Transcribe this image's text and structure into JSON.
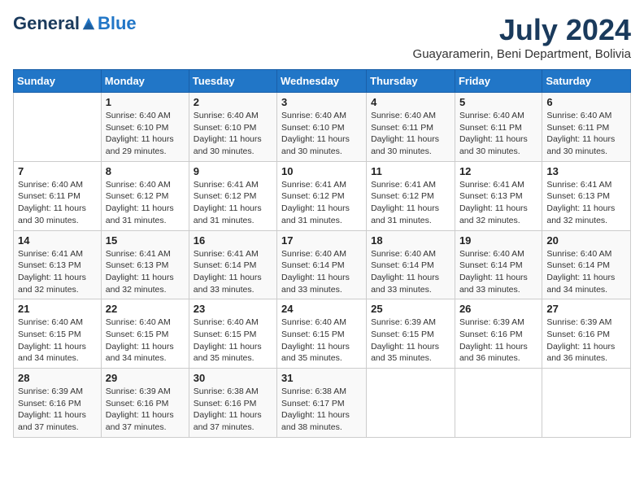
{
  "header": {
    "logo_general": "General",
    "logo_blue": "Blue",
    "month_year": "July 2024",
    "location": "Guayaramerin, Beni Department, Bolivia"
  },
  "weekdays": [
    "Sunday",
    "Monday",
    "Tuesday",
    "Wednesday",
    "Thursday",
    "Friday",
    "Saturday"
  ],
  "weeks": [
    [
      {
        "day": "",
        "sunrise": "",
        "sunset": "",
        "daylight": ""
      },
      {
        "day": "1",
        "sunrise": "Sunrise: 6:40 AM",
        "sunset": "Sunset: 6:10 PM",
        "daylight": "Daylight: 11 hours and 29 minutes."
      },
      {
        "day": "2",
        "sunrise": "Sunrise: 6:40 AM",
        "sunset": "Sunset: 6:10 PM",
        "daylight": "Daylight: 11 hours and 30 minutes."
      },
      {
        "day": "3",
        "sunrise": "Sunrise: 6:40 AM",
        "sunset": "Sunset: 6:10 PM",
        "daylight": "Daylight: 11 hours and 30 minutes."
      },
      {
        "day": "4",
        "sunrise": "Sunrise: 6:40 AM",
        "sunset": "Sunset: 6:11 PM",
        "daylight": "Daylight: 11 hours and 30 minutes."
      },
      {
        "day": "5",
        "sunrise": "Sunrise: 6:40 AM",
        "sunset": "Sunset: 6:11 PM",
        "daylight": "Daylight: 11 hours and 30 minutes."
      },
      {
        "day": "6",
        "sunrise": "Sunrise: 6:40 AM",
        "sunset": "Sunset: 6:11 PM",
        "daylight": "Daylight: 11 hours and 30 minutes."
      }
    ],
    [
      {
        "day": "7",
        "sunrise": "Sunrise: 6:40 AM",
        "sunset": "Sunset: 6:11 PM",
        "daylight": "Daylight: 11 hours and 30 minutes."
      },
      {
        "day": "8",
        "sunrise": "Sunrise: 6:40 AM",
        "sunset": "Sunset: 6:12 PM",
        "daylight": "Daylight: 11 hours and 31 minutes."
      },
      {
        "day": "9",
        "sunrise": "Sunrise: 6:41 AM",
        "sunset": "Sunset: 6:12 PM",
        "daylight": "Daylight: 11 hours and 31 minutes."
      },
      {
        "day": "10",
        "sunrise": "Sunrise: 6:41 AM",
        "sunset": "Sunset: 6:12 PM",
        "daylight": "Daylight: 11 hours and 31 minutes."
      },
      {
        "day": "11",
        "sunrise": "Sunrise: 6:41 AM",
        "sunset": "Sunset: 6:12 PM",
        "daylight": "Daylight: 11 hours and 31 minutes."
      },
      {
        "day": "12",
        "sunrise": "Sunrise: 6:41 AM",
        "sunset": "Sunset: 6:13 PM",
        "daylight": "Daylight: 11 hours and 32 minutes."
      },
      {
        "day": "13",
        "sunrise": "Sunrise: 6:41 AM",
        "sunset": "Sunset: 6:13 PM",
        "daylight": "Daylight: 11 hours and 32 minutes."
      }
    ],
    [
      {
        "day": "14",
        "sunrise": "Sunrise: 6:41 AM",
        "sunset": "Sunset: 6:13 PM",
        "daylight": "Daylight: 11 hours and 32 minutes."
      },
      {
        "day": "15",
        "sunrise": "Sunrise: 6:41 AM",
        "sunset": "Sunset: 6:13 PM",
        "daylight": "Daylight: 11 hours and 32 minutes."
      },
      {
        "day": "16",
        "sunrise": "Sunrise: 6:41 AM",
        "sunset": "Sunset: 6:14 PM",
        "daylight": "Daylight: 11 hours and 33 minutes."
      },
      {
        "day": "17",
        "sunrise": "Sunrise: 6:40 AM",
        "sunset": "Sunset: 6:14 PM",
        "daylight": "Daylight: 11 hours and 33 minutes."
      },
      {
        "day": "18",
        "sunrise": "Sunrise: 6:40 AM",
        "sunset": "Sunset: 6:14 PM",
        "daylight": "Daylight: 11 hours and 33 minutes."
      },
      {
        "day": "19",
        "sunrise": "Sunrise: 6:40 AM",
        "sunset": "Sunset: 6:14 PM",
        "daylight": "Daylight: 11 hours and 33 minutes."
      },
      {
        "day": "20",
        "sunrise": "Sunrise: 6:40 AM",
        "sunset": "Sunset: 6:14 PM",
        "daylight": "Daylight: 11 hours and 34 minutes."
      }
    ],
    [
      {
        "day": "21",
        "sunrise": "Sunrise: 6:40 AM",
        "sunset": "Sunset: 6:15 PM",
        "daylight": "Daylight: 11 hours and 34 minutes."
      },
      {
        "day": "22",
        "sunrise": "Sunrise: 6:40 AM",
        "sunset": "Sunset: 6:15 PM",
        "daylight": "Daylight: 11 hours and 34 minutes."
      },
      {
        "day": "23",
        "sunrise": "Sunrise: 6:40 AM",
        "sunset": "Sunset: 6:15 PM",
        "daylight": "Daylight: 11 hours and 35 minutes."
      },
      {
        "day": "24",
        "sunrise": "Sunrise: 6:40 AM",
        "sunset": "Sunset: 6:15 PM",
        "daylight": "Daylight: 11 hours and 35 minutes."
      },
      {
        "day": "25",
        "sunrise": "Sunrise: 6:39 AM",
        "sunset": "Sunset: 6:15 PM",
        "daylight": "Daylight: 11 hours and 35 minutes."
      },
      {
        "day": "26",
        "sunrise": "Sunrise: 6:39 AM",
        "sunset": "Sunset: 6:16 PM",
        "daylight": "Daylight: 11 hours and 36 minutes."
      },
      {
        "day": "27",
        "sunrise": "Sunrise: 6:39 AM",
        "sunset": "Sunset: 6:16 PM",
        "daylight": "Daylight: 11 hours and 36 minutes."
      }
    ],
    [
      {
        "day": "28",
        "sunrise": "Sunrise: 6:39 AM",
        "sunset": "Sunset: 6:16 PM",
        "daylight": "Daylight: 11 hours and 37 minutes."
      },
      {
        "day": "29",
        "sunrise": "Sunrise: 6:39 AM",
        "sunset": "Sunset: 6:16 PM",
        "daylight": "Daylight: 11 hours and 37 minutes."
      },
      {
        "day": "30",
        "sunrise": "Sunrise: 6:38 AM",
        "sunset": "Sunset: 6:16 PM",
        "daylight": "Daylight: 11 hours and 37 minutes."
      },
      {
        "day": "31",
        "sunrise": "Sunrise: 6:38 AM",
        "sunset": "Sunset: 6:17 PM",
        "daylight": "Daylight: 11 hours and 38 minutes."
      },
      {
        "day": "",
        "sunrise": "",
        "sunset": "",
        "daylight": ""
      },
      {
        "day": "",
        "sunrise": "",
        "sunset": "",
        "daylight": ""
      },
      {
        "day": "",
        "sunrise": "",
        "sunset": "",
        "daylight": ""
      }
    ]
  ]
}
